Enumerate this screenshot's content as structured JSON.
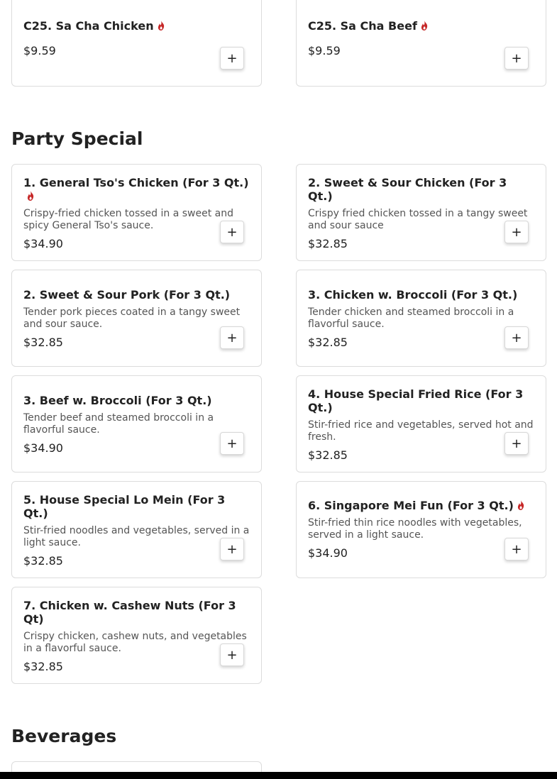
{
  "top_items": [
    {
      "name": "C25. Sa Cha Chicken",
      "price": "$9.59",
      "spicy": true
    },
    {
      "name": "C25. Sa Cha Beef",
      "price": "$9.59",
      "spicy": true
    }
  ],
  "sections": {
    "party_special": {
      "title": "Party Special",
      "items": [
        {
          "name": "1. General Tso's Chicken (For 3 Qt.)",
          "desc": "Crispy-fried chicken tossed in a sweet and spicy General Tso's sauce.",
          "price": "$34.90",
          "spicy": true
        },
        {
          "name": "2. Sweet & Sour Chicken (For 3 Qt.)",
          "desc": "Crispy fried chicken tossed in a tangy sweet and sour sauce",
          "price": "$32.85",
          "spicy": false
        },
        {
          "name": "2. Sweet & Sour Pork (For 3 Qt.)",
          "desc": "Tender pork pieces coated in a tangy sweet and sour sauce.",
          "price": "$32.85",
          "spicy": false
        },
        {
          "name": "3. Chicken w. Broccoli (For 3 Qt.)",
          "desc": "Tender chicken and steamed broccoli in a flavorful sauce.",
          "price": "$32.85",
          "spicy": false
        },
        {
          "name": "3. Beef w. Broccoli (For 3 Qt.)",
          "desc": "Tender beef and steamed broccoli in a flavorful sauce.",
          "price": "$34.90",
          "spicy": false
        },
        {
          "name": "4. House Special Fried Rice (For 3 Qt.)",
          "desc": "Stir-fried rice and vegetables, served hot and fresh.",
          "price": "$32.85",
          "spicy": false
        },
        {
          "name": "5. House Special Lo Mein (For 3 Qt.)",
          "desc": "Stir-fried noodles and vegetables, served in a light sauce.",
          "price": "$32.85",
          "spicy": false
        },
        {
          "name": "6. Singapore Mei Fun (For 3 Qt.)",
          "desc": "Stir-fried thin rice noodles with vegetables, served in a light sauce.",
          "price": "$34.90",
          "spicy": true
        },
        {
          "name": "7. Chicken w. Cashew Nuts (For 3 Qt)",
          "desc": "Crispy chicken, cashew nuts, and vegetables in a flavorful sauce.",
          "price": "$32.85",
          "spicy": false
        }
      ]
    },
    "beverages": {
      "title": "Beverages"
    }
  },
  "ui": {
    "add_label": "+",
    "spicy_icon": "flame-icon",
    "spicy_color": "#c62828"
  }
}
